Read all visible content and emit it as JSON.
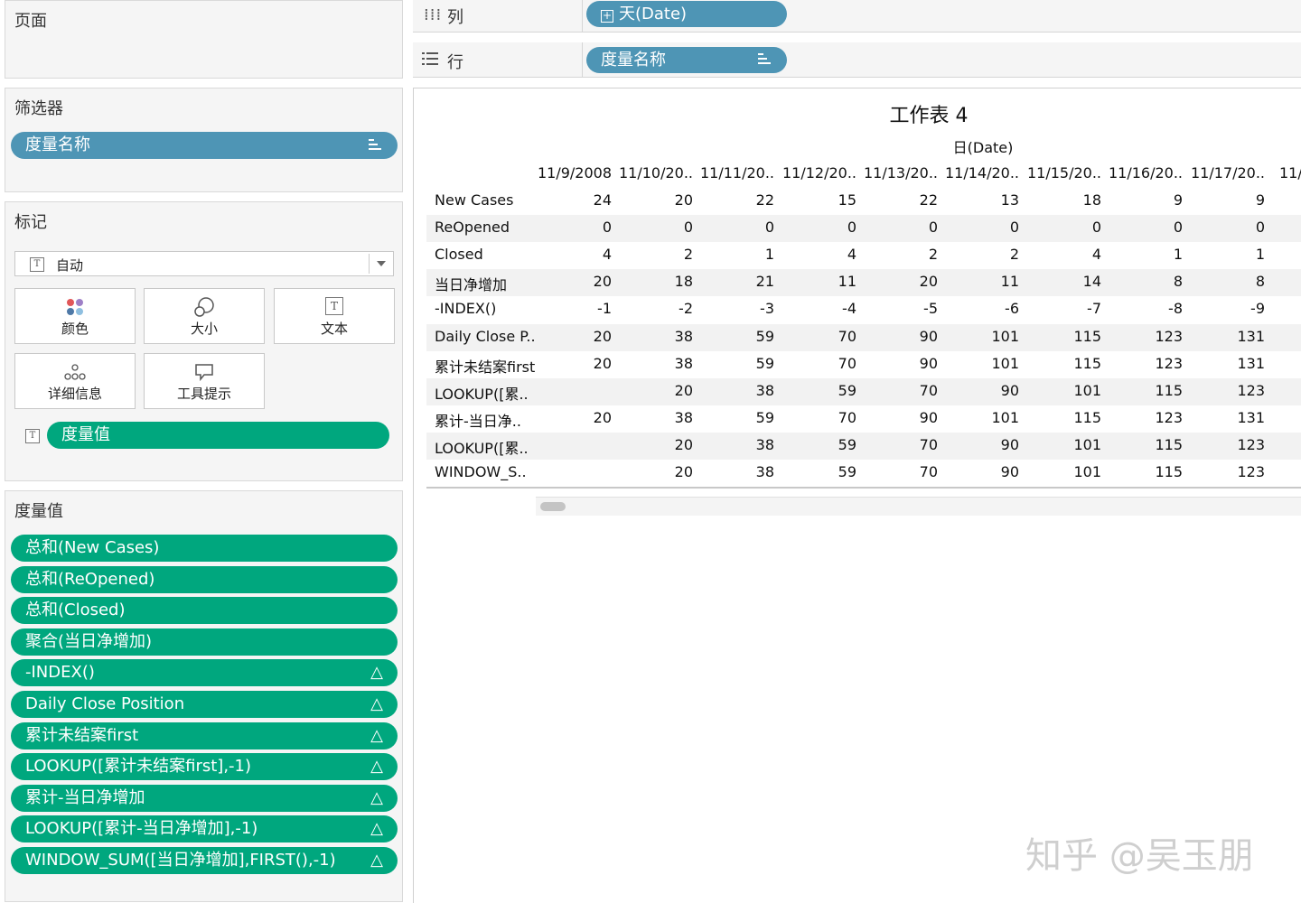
{
  "pages_panel": {
    "title": "页面"
  },
  "filters_panel": {
    "title": "筛选器",
    "pill": "度量名称"
  },
  "marks_panel": {
    "title": "标记",
    "dropdown_value": "自动",
    "buttons": [
      "颜色",
      "大小",
      "文本",
      "详细信息",
      "工具提示"
    ],
    "text_pill": "度量值"
  },
  "measure_values_panel": {
    "title": "度量值",
    "items": [
      "总和(New Cases)",
      "总和(ReOpened)",
      "总和(Closed)",
      "聚合(当日净增加)",
      "-INDEX()",
      "Daily Close Position",
      "累计未结案first",
      "LOOKUP([累计未结案first],-1)",
      "累计-当日净增加",
      "LOOKUP([累计-当日净增加],-1)",
      "WINDOW_SUM([当日净增加],FIRST(),-1)"
    ],
    "triangle": "△"
  },
  "columns_shelf": {
    "label": "列",
    "pill": "天(Date)"
  },
  "rows_shelf": {
    "label": "行",
    "pill": "度量名称"
  },
  "sheet": {
    "title": "工作表 4",
    "date_header": "日(Date)",
    "columns": [
      "11/9/2008",
      "11/10/20..",
      "11/11/20..",
      "11/12/20..",
      "11/13/20..",
      "11/14/20..",
      "11/15/20..",
      "11/16/20..",
      "11/17/20..",
      "11/"
    ],
    "rows": [
      {
        "label": "New Cases",
        "values": [
          "24",
          "20",
          "22",
          "15",
          "22",
          "13",
          "18",
          "9",
          "9"
        ]
      },
      {
        "label": "ReOpened",
        "values": [
          "0",
          "0",
          "0",
          "0",
          "0",
          "0",
          "0",
          "0",
          "0"
        ]
      },
      {
        "label": "Closed",
        "values": [
          "4",
          "2",
          "1",
          "4",
          "2",
          "2",
          "4",
          "1",
          "1"
        ]
      },
      {
        "label": "当日净增加",
        "values": [
          "20",
          "18",
          "21",
          "11",
          "20",
          "11",
          "14",
          "8",
          "8"
        ]
      },
      {
        "label": "-INDEX()",
        "values": [
          "-1",
          "-2",
          "-3",
          "-4",
          "-5",
          "-6",
          "-7",
          "-8",
          "-9"
        ]
      },
      {
        "label": "Daily Close P..",
        "values": [
          "20",
          "38",
          "59",
          "70",
          "90",
          "101",
          "115",
          "123",
          "131"
        ]
      },
      {
        "label": "累计未结案first",
        "values": [
          "20",
          "38",
          "59",
          "70",
          "90",
          "101",
          "115",
          "123",
          "131"
        ]
      },
      {
        "label": "LOOKUP([累..",
        "values": [
          "",
          "20",
          "38",
          "59",
          "70",
          "90",
          "101",
          "115",
          "123"
        ]
      },
      {
        "label": "累计-当日净..",
        "values": [
          "20",
          "38",
          "59",
          "70",
          "90",
          "101",
          "115",
          "123",
          "131"
        ]
      },
      {
        "label": "LOOKUP([累..",
        "values": [
          "",
          "20",
          "38",
          "59",
          "70",
          "90",
          "101",
          "115",
          "123"
        ]
      },
      {
        "label": "WINDOW_S..",
        "values": [
          "",
          "20",
          "38",
          "59",
          "70",
          "90",
          "101",
          "115",
          "123"
        ]
      }
    ]
  },
  "watermark": "知乎 @吴玉朋"
}
